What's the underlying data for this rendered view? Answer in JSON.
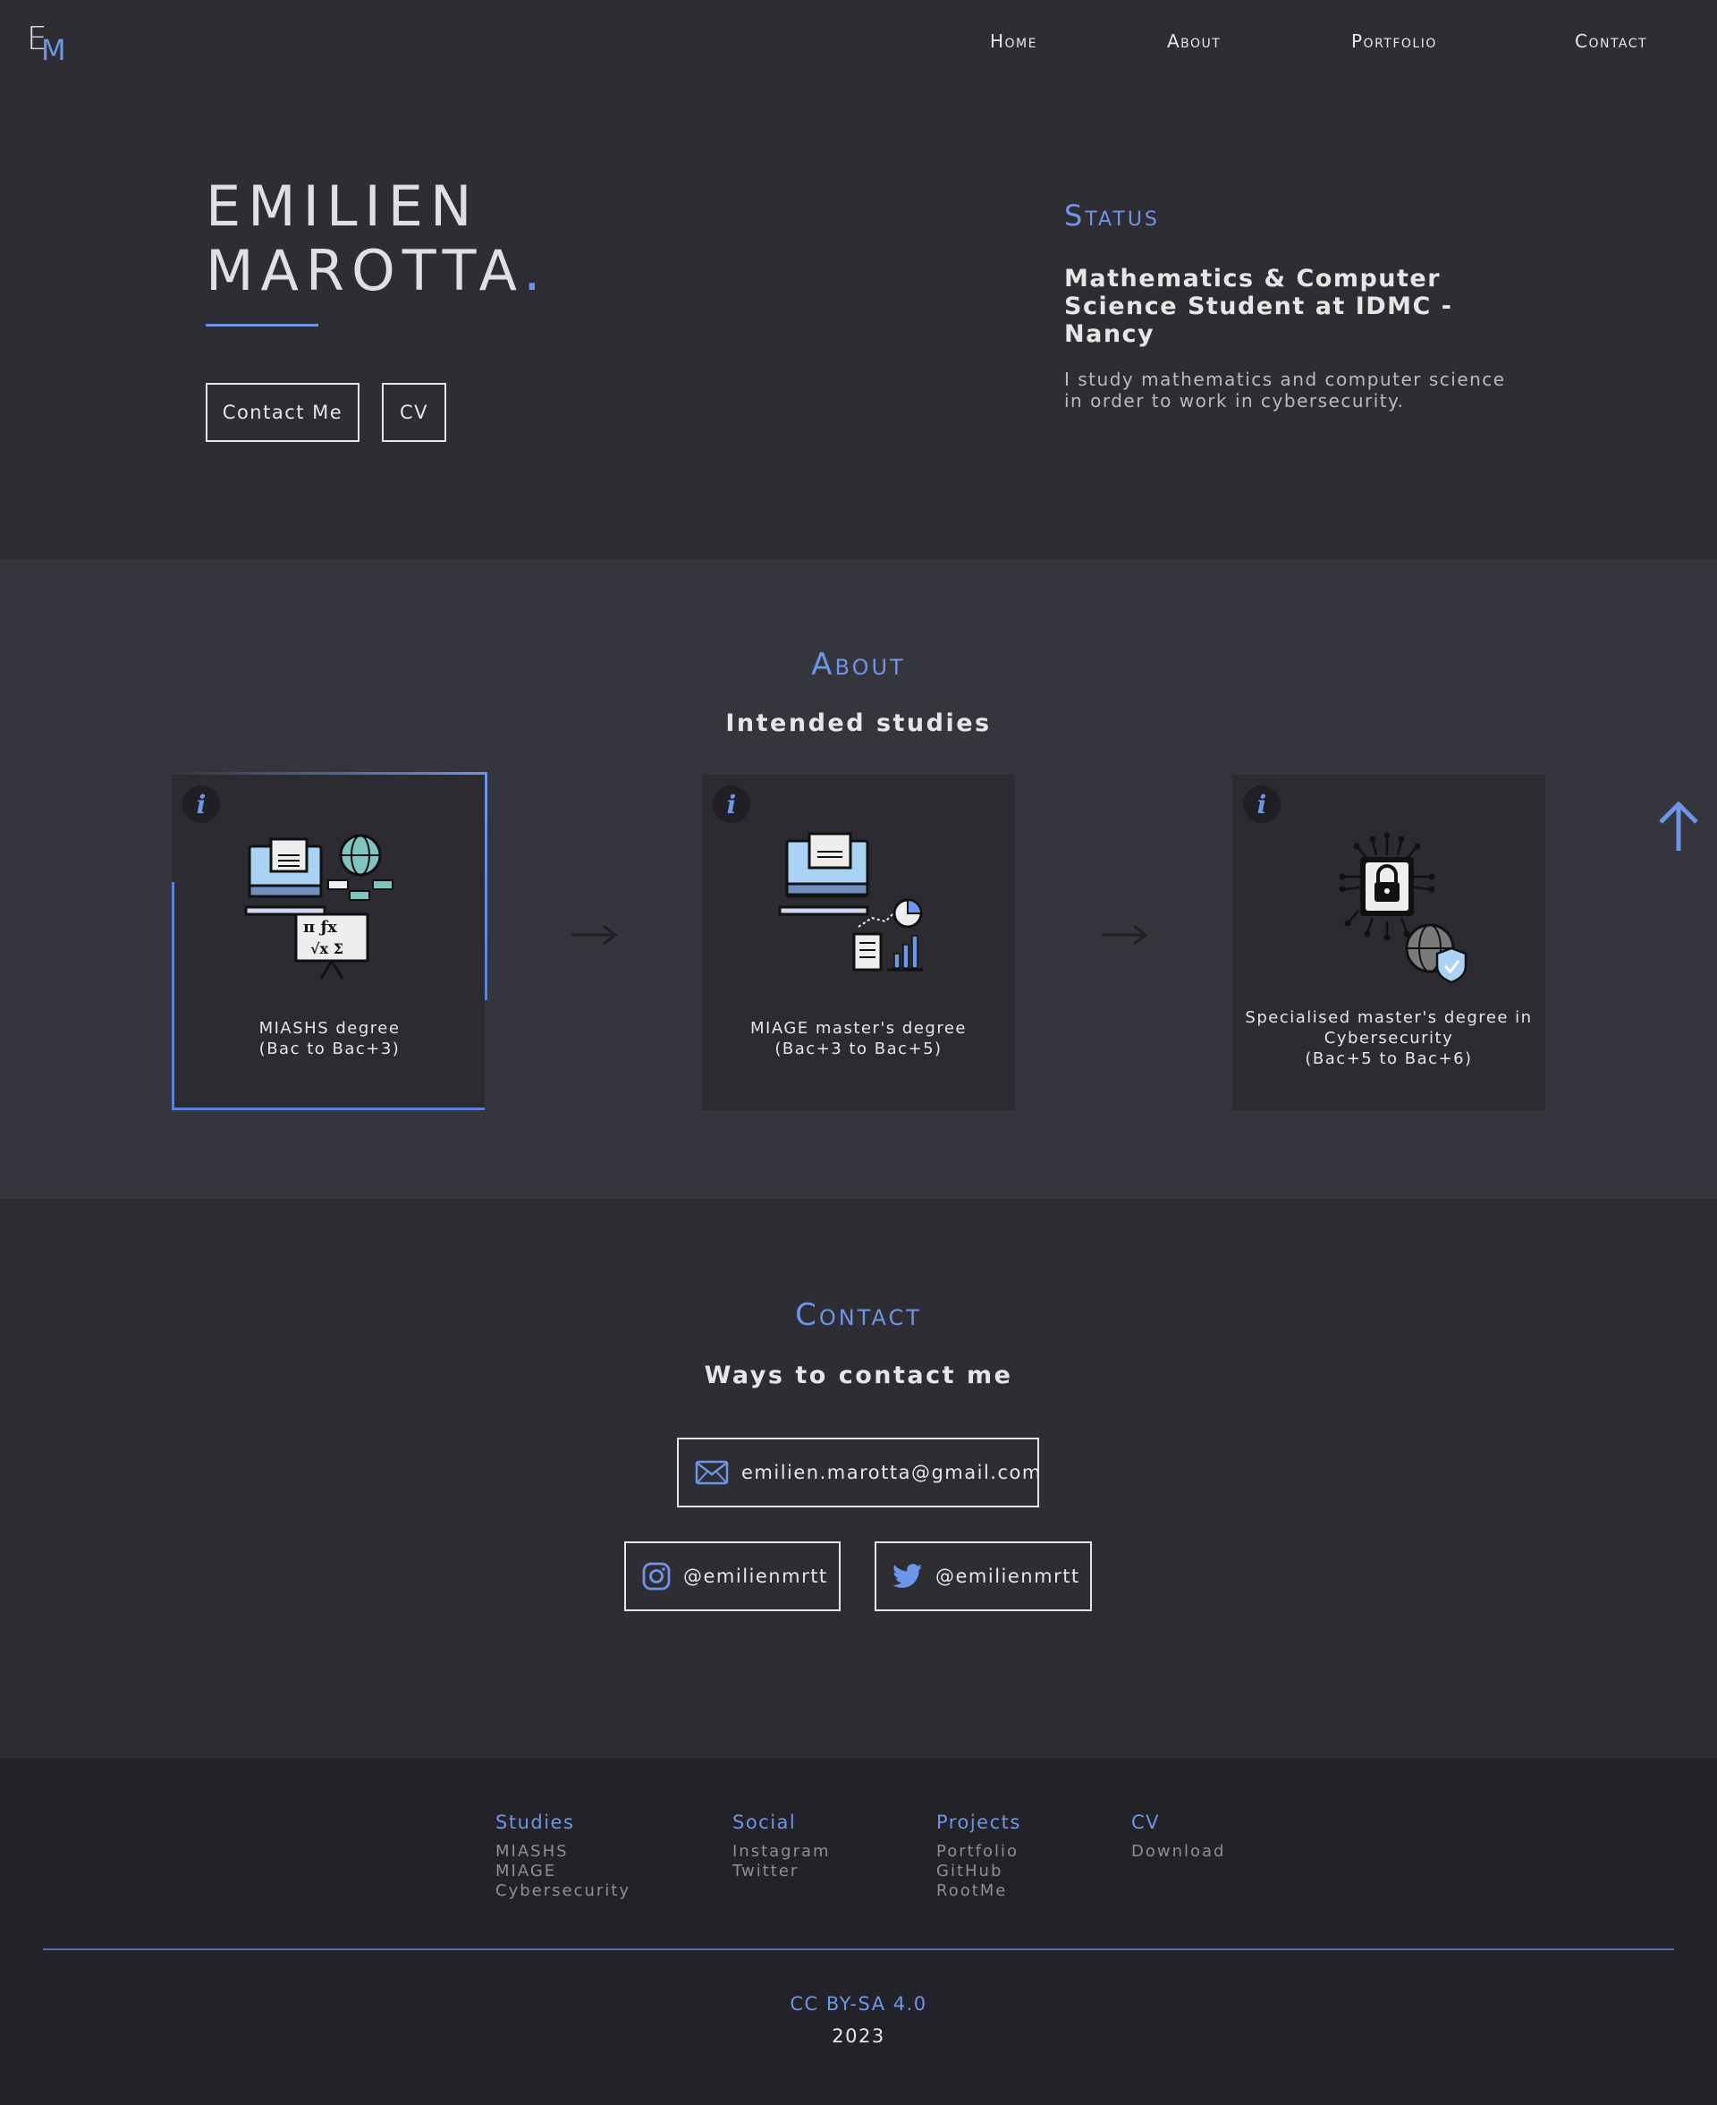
{
  "nav": {
    "logo_e": "E",
    "logo_m": "M",
    "links": [
      "Home",
      "About",
      "Portfolio",
      "Contact"
    ]
  },
  "hero": {
    "name_line1": "EMILIEN",
    "name_line2": "MAROTTA",
    "name_dot": ".",
    "buttons": {
      "contact": "Contact Me",
      "cv": "CV"
    },
    "status_title": "Status",
    "status_heading": "Mathematics & Computer Science Student at IDMC - Nancy",
    "status_body": "I study mathematics and computer science in order to work in cybersecurity."
  },
  "about": {
    "title": "About",
    "subtitle": "Intended studies",
    "info_glyph": "i",
    "cards": [
      {
        "line1": "MIASHS degree",
        "line2": "(Bac to Bac+3)",
        "icon": "math-computer-icon"
      },
      {
        "line1": "MIAGE master's degree",
        "line2": "(Bac+3 to Bac+5)",
        "icon": "data-computer-icon"
      },
      {
        "line1": "Specialised master's degree in",
        "line2": "Cybersecurity",
        "line3": "(Bac+5 to Bac+6)",
        "icon": "security-lock-icon"
      }
    ]
  },
  "contact": {
    "title": "Contact",
    "subtitle": "Ways to contact me",
    "email": "emilien.marotta@gmail.com",
    "instagram": "@emilienmrtt",
    "twitter": "@emilienmrtt"
  },
  "footer": {
    "columns": [
      {
        "title": "Studies",
        "links": [
          "MIASHS",
          "MIAGE",
          "Cybersecurity"
        ]
      },
      {
        "title": "Social",
        "links": [
          "Instagram",
          "Twitter"
        ]
      },
      {
        "title": "Projects",
        "links": [
          "Portfolio",
          "GitHub",
          "RootMe"
        ]
      },
      {
        "title": "CV",
        "links": [
          "Download"
        ]
      }
    ],
    "license": "CC BY-SA 4.0",
    "year": "2023"
  },
  "colors": {
    "accent": "#6d95e8",
    "background": "#2d2d33",
    "about_bg": "#35363d",
    "footer_bg": "#222228"
  }
}
